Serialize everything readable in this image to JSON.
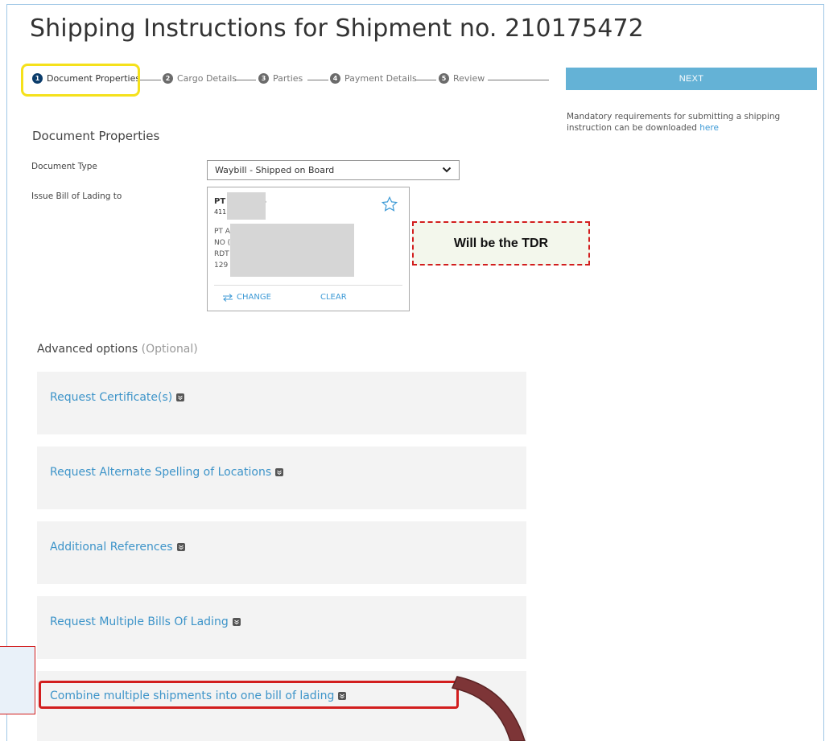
{
  "page": {
    "title": "Shipping Instructions for Shipment no. 210175472"
  },
  "stepper": {
    "steps": [
      {
        "num": "1",
        "label": "Document Properties"
      },
      {
        "num": "2",
        "label": "Cargo Details"
      },
      {
        "num": "3",
        "label": "Parties"
      },
      {
        "num": "4",
        "label": "Payment Details"
      },
      {
        "num": "5",
        "label": "Review"
      }
    ],
    "active_step": 1
  },
  "next_button": {
    "label": "NEXT"
  },
  "mandatory_note": {
    "text": "Mandatory requirements for submitting a shipping instruction can be downloaded ",
    "link": "here"
  },
  "document_properties": {
    "heading": "Document Properties",
    "document_type": {
      "label": "Document Type",
      "value": "Waybill - Shipped on Board"
    },
    "issue_bl_to": {
      "label": "Issue Bill of Lading to",
      "party_name": "PT A    ISTICS",
      "party_code": "411",
      "address_lines": [
        "PT A",
        "NO (",
        "RDT",
        "129"
      ],
      "change_label": "CHANGE",
      "clear_label": "CLEAR"
    }
  },
  "annotation": {
    "tdr_note": "Will be the TDR"
  },
  "advanced_options": {
    "heading": "Advanced options",
    "optional": "(Optional)",
    "items": [
      {
        "label": "Request Certificate(s)"
      },
      {
        "label": "Request Alternate Spelling of Locations"
      },
      {
        "label": "Additional References"
      },
      {
        "label": "Request Multiple Bills Of Lading"
      },
      {
        "label": "Combine multiple shipments into one bill of lading"
      }
    ]
  },
  "colors": {
    "accent": "#64b2d6",
    "link": "#3d94c9",
    "highlight_yellow": "#f5e11b",
    "highlight_red": "#d21e1e"
  }
}
